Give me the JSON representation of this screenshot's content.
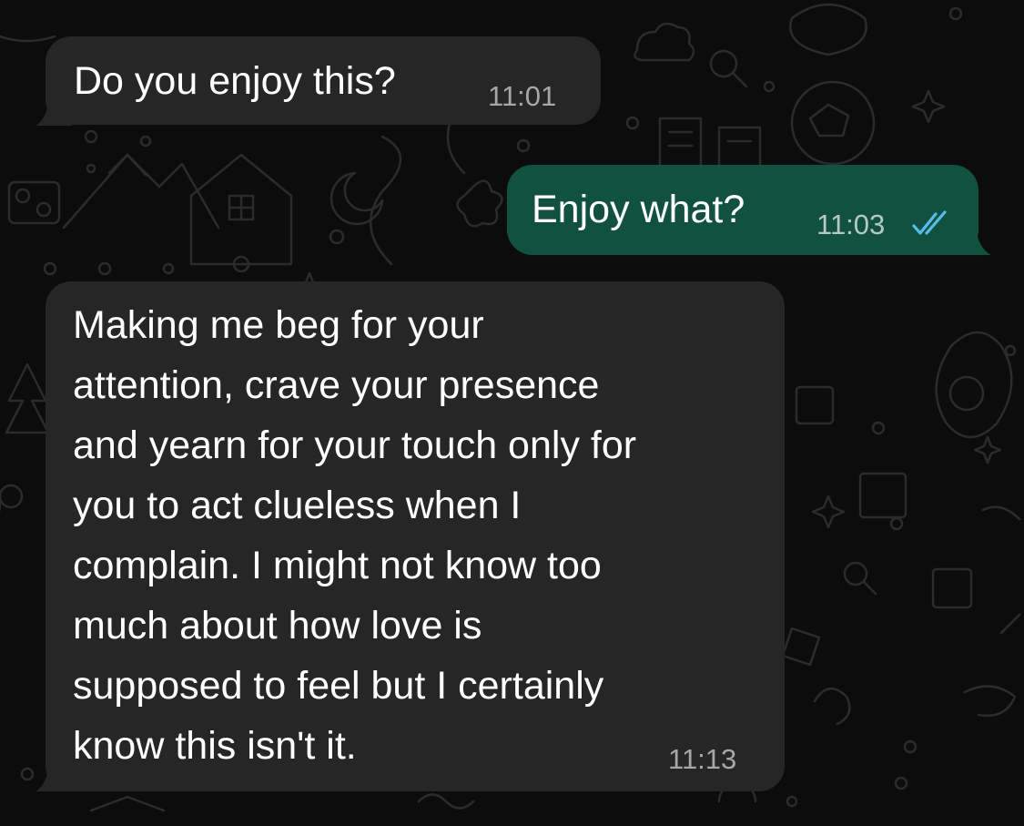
{
  "colors": {
    "background": "#0b0c0b",
    "incoming_bubble": "#252625",
    "outgoing_bubble": "#11513f",
    "read_ticks": "#53bdeb",
    "timestamp": "#a6a8a7"
  },
  "messages": [
    {
      "direction": "incoming",
      "text": "Do you enjoy this?",
      "time": "11:01"
    },
    {
      "direction": "outgoing",
      "text": "Enjoy what?",
      "time": "11:03",
      "status_icon": "double-check-read-icon"
    },
    {
      "direction": "incoming",
      "text": "Making me beg for your\nattention, crave your presence\nand yearn for your touch only for\nyou to act clueless when I\ncomplain. I might not know too\nmuch about how love is\nsupposed to feel but I certainly\nknow this isn't it.",
      "time": "11:13"
    }
  ]
}
